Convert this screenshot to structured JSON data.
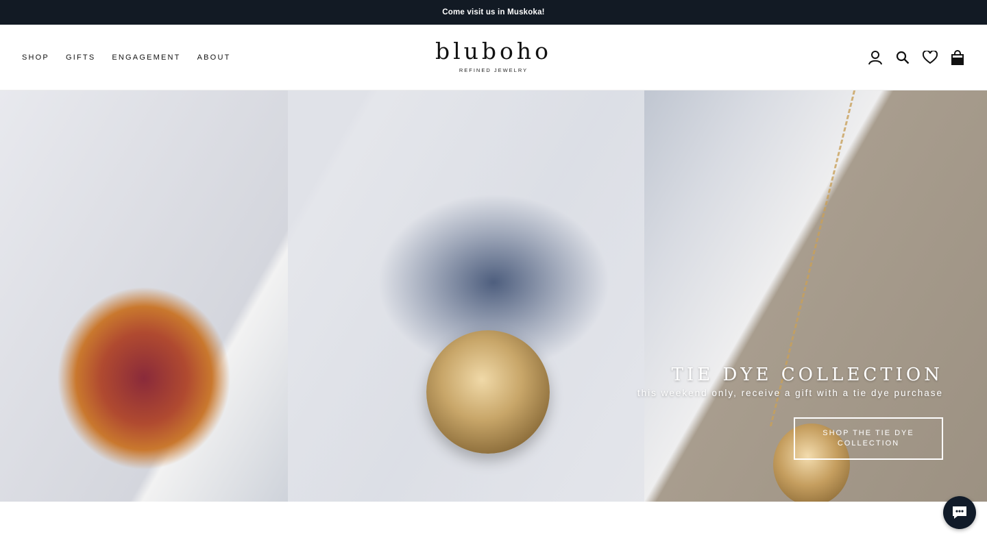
{
  "announcement": "Come visit us in Muskoka!",
  "nav": {
    "items": [
      "Shop",
      "Gifts",
      "Engagement",
      "About"
    ]
  },
  "logo": {
    "wordmark": "bluboho",
    "tagline": "REFINED JEWELRY"
  },
  "header_icons": [
    "account-icon",
    "search-icon",
    "wishlist-heart-icon",
    "cart-bag-icon"
  ],
  "hero": {
    "title": "TIE DYE COLLECTION",
    "subtitle": "this weekend only, receive a gift with a tie dye purchase",
    "button_label": "SHOP THE TIE DYE COLLECTION"
  },
  "chat": {
    "icon": "chat-bubble-icon"
  }
}
